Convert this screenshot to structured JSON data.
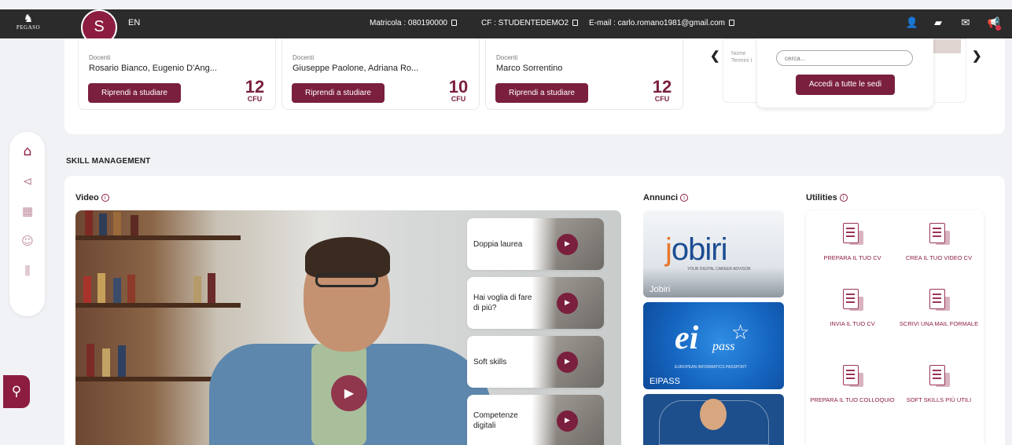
{
  "topbar": {
    "logo_text": "PEGASO",
    "avatar_letter": "S",
    "language": "EN",
    "matricola": "Matricola : 080190000",
    "cf": "CF : STUDENTEDEMO2",
    "email": "E-mail : carlo.romano1981@gmail.com"
  },
  "courses": [
    {
      "docenti_label": "Docenti",
      "docenti": "Rosario Bianco, Eugenio D'Ang...",
      "button": "Riprendi a studiare",
      "cfu": "12",
      "cfu_unit": "CFU"
    },
    {
      "docenti_label": "Docenti",
      "docenti": "Giuseppe Paolone, Adriana Ro...",
      "button": "Riprendi a studiare",
      "cfu": "10",
      "cfu_unit": "CFU"
    },
    {
      "docenti_label": "Docenti",
      "docenti": "Marco Sorrentino",
      "button": "Riprendi a studiare",
      "cfu": "12",
      "cfu_unit": "CFU"
    }
  ],
  "sedi": {
    "ghost_label": "Nome",
    "ghost_value": "Termini I",
    "search_placeholder": "cerca...",
    "button": "Accedi a tutte le sedi"
  },
  "skill_management": {
    "title": "SKILL MANAGEMENT",
    "video_title": "Video",
    "annunci_title": "Annunci",
    "utilities_title": "Utilities",
    "videos": [
      {
        "label": "Doppia laurea"
      },
      {
        "label": "Hai voglia di fare di più?"
      },
      {
        "label": "Soft skills"
      },
      {
        "label": "Competenze digitali"
      }
    ],
    "annunci": [
      {
        "caption": "Jobiri",
        "brand": "obiri",
        "brand_initial": "j",
        "tagline": "YOUR DIGITAL CAREER ADVISOR"
      },
      {
        "caption": "EIPASS",
        "brand": "ei",
        "brand2": "pass",
        "tagline": "EUROPEAN INFORMATICS PASSPORT"
      }
    ],
    "utilities": [
      {
        "label": "PREPARA IL TUO CV"
      },
      {
        "label": "CREA IL TUO VIDEO CV"
      },
      {
        "label": "INVIA IL TUO CV"
      },
      {
        "label": "SCRIVI UNA MAIL FORMALE"
      },
      {
        "label": "PREPARA IL TUO COLLOQUIO"
      },
      {
        "label": "SOFT SKILLS PIÙ UTILI"
      }
    ]
  },
  "colors": {
    "brand": "#8c1d40",
    "button": "#7a1f3d",
    "topbar": "#2b2b2b"
  },
  "icons": {
    "sidenav": [
      "home-icon",
      "megaphone-icon",
      "calculator-icon",
      "head-icon",
      "chart-icon"
    ],
    "topbar": [
      "user-icon",
      "chat-icon",
      "mail-icon",
      "announce-icon"
    ]
  }
}
